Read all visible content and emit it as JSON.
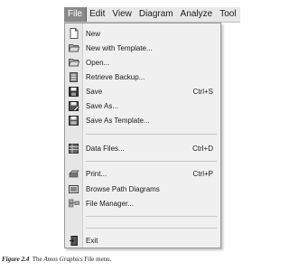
{
  "menubar": {
    "items": [
      {
        "label": "File"
      },
      {
        "label": "Edit"
      },
      {
        "label": "View"
      },
      {
        "label": "Diagram"
      },
      {
        "label": "Analyze"
      },
      {
        "label": "Tool"
      }
    ]
  },
  "file_menu": {
    "items": [
      {
        "label": "New",
        "shortcut": "",
        "icon": "new-file-icon"
      },
      {
        "label": "New with Template...",
        "shortcut": "",
        "icon": "folder-open-icon"
      },
      {
        "label": "Open...",
        "shortcut": "",
        "icon": "folder-open-icon"
      },
      {
        "label": "Retrieve Backup...",
        "shortcut": "",
        "icon": "backup-icon"
      },
      {
        "label": "Save",
        "shortcut": "Ctrl+S",
        "icon": "save-icon"
      },
      {
        "label": "Save As...",
        "shortcut": "",
        "icon": "save-as-icon"
      },
      {
        "label": "Save As  Template...",
        "shortcut": "",
        "icon": "save-template-icon"
      },
      {
        "label": "Data Files...",
        "shortcut": "Ctrl+D",
        "icon": "data-files-icon"
      },
      {
        "label": "Print...",
        "shortcut": "Ctrl+P",
        "icon": "print-icon"
      },
      {
        "label": "Browse Path Diagrams",
        "shortcut": "",
        "icon": "browse-icon"
      },
      {
        "label": "File Manager...",
        "shortcut": "",
        "icon": "file-manager-icon"
      },
      {
        "label": "Exit",
        "shortcut": "",
        "icon": "exit-icon"
      }
    ]
  },
  "caption": {
    "figure": "Figure 2.4",
    "pre": "  The ",
    "app": "Amos Graphics",
    "post": " File menu."
  }
}
